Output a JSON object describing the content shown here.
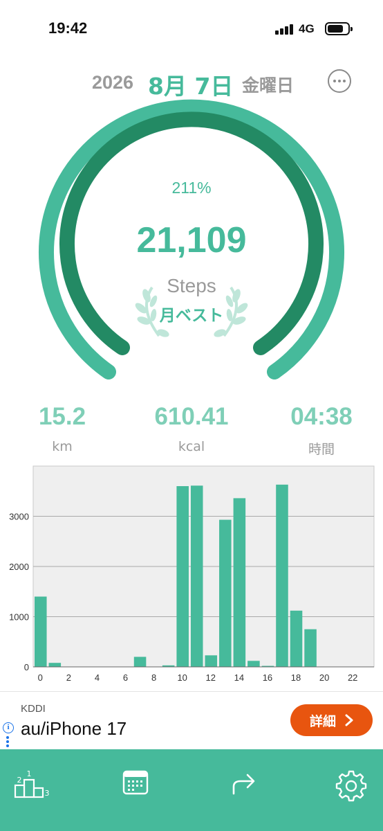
{
  "status_bar": {
    "time": "19:42",
    "network": "4G"
  },
  "date": {
    "year": "2026",
    "month_day": "8月 7日",
    "weekday": "金曜日"
  },
  "summary": {
    "percent": "211%",
    "steps": "21,109",
    "steps_unit": "Steps",
    "badge": "月ベスト",
    "goal_progress": 2.11
  },
  "stats": [
    {
      "value": "15.2",
      "unit": "km"
    },
    {
      "value": "610.41",
      "unit": "kcal"
    },
    {
      "value": "04:38",
      "unit": "時間"
    }
  ],
  "chart_data": {
    "type": "bar",
    "title": "",
    "xlabel": "",
    "ylabel": "",
    "x": [
      0,
      1,
      2,
      3,
      4,
      5,
      6,
      7,
      8,
      9,
      10,
      11,
      12,
      13,
      14,
      15,
      16,
      17,
      18,
      19,
      20,
      21,
      22,
      23
    ],
    "values": [
      1400,
      80,
      0,
      0,
      0,
      0,
      0,
      200,
      0,
      30,
      3600,
      3610,
      230,
      2930,
      3360,
      120,
      20,
      3630,
      1120,
      750,
      0,
      0,
      0,
      0
    ],
    "x_ticks": [
      "0",
      "2",
      "4",
      "6",
      "8",
      "10",
      "12",
      "14",
      "16",
      "18",
      "20",
      "22"
    ],
    "y_ticks": [
      "0",
      "1000",
      "2000",
      "3000"
    ],
    "ylim": [
      0,
      4000
    ],
    "grid": true,
    "bar_color": "#46ba9b",
    "background": "#efefef"
  },
  "ad": {
    "advertiser": "KDDI",
    "title": "au/iPhone 17",
    "cta": "詳細",
    "info": "i"
  },
  "tabs": [
    {
      "name": "ranking",
      "icon": "podium-icon"
    },
    {
      "name": "calendar",
      "icon": "calendar-icon"
    },
    {
      "name": "share",
      "icon": "share-icon"
    },
    {
      "name": "settings",
      "icon": "gear-icon"
    }
  ],
  "colors": {
    "accent": "#46ba9b",
    "ring_outer": "#46ba9b",
    "ring_inner": "#238a64",
    "ad_button": "#e8550f",
    "muted": "#9a9a9a"
  }
}
